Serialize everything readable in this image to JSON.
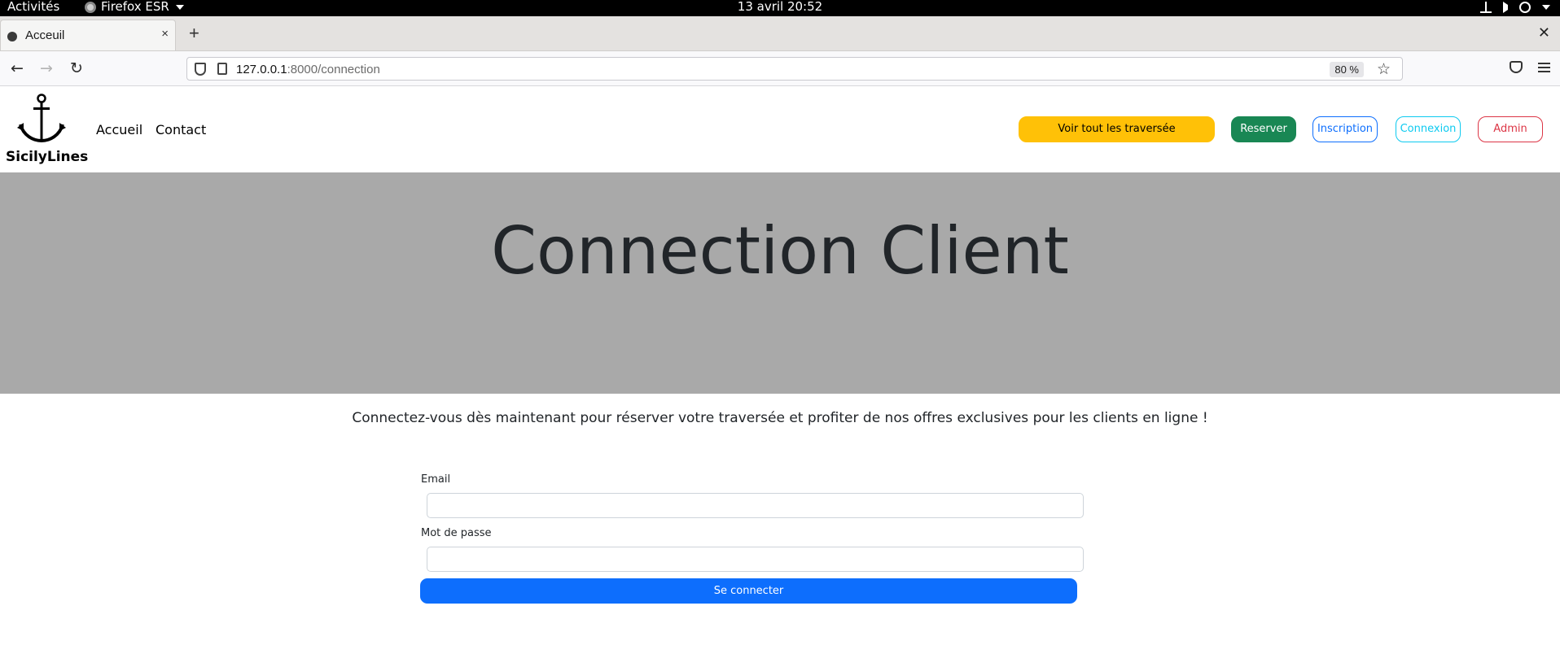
{
  "system_bar": {
    "activities": "Activités",
    "app_name": "Firefox ESR",
    "clock": "13 avril  20:52"
  },
  "browser": {
    "tab_title": "Acceuil",
    "tab_close": "×",
    "new_tab": "+",
    "window_close": "✕",
    "url_host": "127.0.0.1",
    "url_rest": ":8000/connection",
    "zoom": "80 %"
  },
  "site": {
    "brand_name": "SicilyLines",
    "nav": [
      "Accueil",
      "Contact"
    ],
    "buttons": {
      "all_crossings": "Voir tout les traversée",
      "book": "Reserver",
      "register": "Inscription",
      "login": "Connexion",
      "admin": "Admin"
    }
  },
  "hero": {
    "title": "Connection Client"
  },
  "intro_text": "Connectez-vous dès maintenant pour réserver votre traversée et profiter de nos offres exclusives pour les clients en ligne !",
  "form": {
    "email_label": "Email",
    "email_value": "",
    "password_label": "Mot de passe",
    "password_value": "",
    "submit_label": "Se connecter"
  },
  "colors": {
    "warning": "#ffc107",
    "success": "#198754",
    "primary": "#0d6efd",
    "info": "#0dcaf0",
    "danger": "#dc3545",
    "hero_bg": "#a9a9a9"
  }
}
